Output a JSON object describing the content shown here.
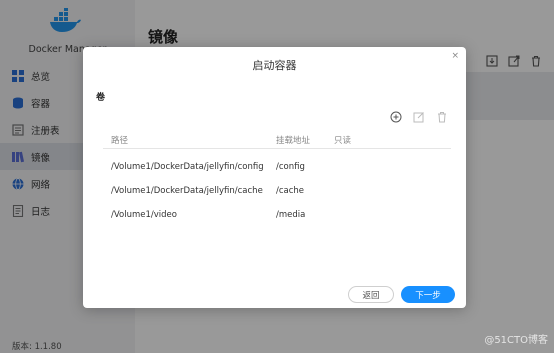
{
  "app": {
    "name": "Docker Manager",
    "version": "版本: 1.1.80",
    "page_title": "镜像"
  },
  "sidebar": {
    "items": [
      {
        "label": "总览",
        "icon": "dashboard-icon"
      },
      {
        "label": "容器",
        "icon": "container-icon"
      },
      {
        "label": "注册表",
        "icon": "registry-icon"
      },
      {
        "label": "镜像",
        "icon": "image-icon",
        "active": true
      },
      {
        "label": "网络",
        "icon": "network-icon"
      },
      {
        "label": "日志",
        "icon": "log-icon"
      }
    ]
  },
  "toolbar": {
    "icons": [
      "import-icon",
      "export-icon",
      "delete-icon"
    ]
  },
  "modal": {
    "title": "启动容器",
    "close": "×",
    "section": "卷",
    "tools": [
      "add-icon",
      "edit-icon",
      "delete-icon"
    ],
    "columns": {
      "path": "路径",
      "mount": "挂载地址",
      "readonly": "只读"
    },
    "rows": [
      {
        "path": "/Volume1/DockerData/jellyfin/config",
        "mount": "/config"
      },
      {
        "path": "/Volume1/DockerData/jellyfin/cache",
        "mount": "/cache"
      },
      {
        "path": "/Volume1/video",
        "mount": "/media"
      }
    ],
    "back_label": "返回",
    "next_label": "下一步"
  },
  "watermark": "@51CTO博客",
  "colors": {
    "primary": "#1890ff",
    "sidebar_bg": "#f3f4f6",
    "overlay": "rgba(0,0,0,0.40)"
  }
}
